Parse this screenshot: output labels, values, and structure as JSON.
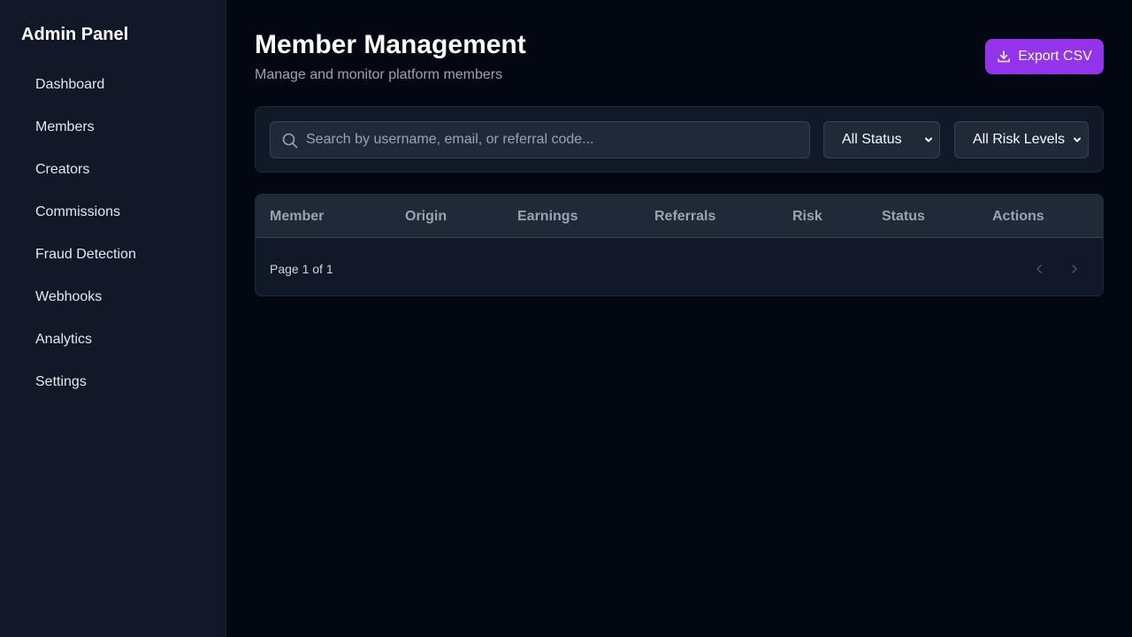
{
  "sidebar": {
    "brand": "Admin Panel",
    "items": [
      {
        "label": "Dashboard"
      },
      {
        "label": "Members"
      },
      {
        "label": "Creators"
      },
      {
        "label": "Commissions"
      },
      {
        "label": "Fraud Detection"
      },
      {
        "label": "Webhooks"
      },
      {
        "label": "Analytics"
      },
      {
        "label": "Settings"
      }
    ]
  },
  "header": {
    "title": "Member Management",
    "subtitle": "Manage and monitor platform members",
    "export_label": "Export CSV"
  },
  "filters": {
    "search_placeholder": "Search by username, email, or referral code...",
    "search_value": "",
    "status_selected": "All Status",
    "risk_selected": "All Risk Levels"
  },
  "table": {
    "columns": [
      "Member",
      "Origin",
      "Earnings",
      "Referrals",
      "Risk",
      "Status",
      "Actions"
    ],
    "rows": [],
    "pagination": "Page 1 of 1"
  },
  "colors": {
    "accent": "#9333ea",
    "background": "#030712",
    "surface": "#111827"
  },
  "icons": {
    "export": "download-icon",
    "search": "search-icon",
    "select": "chevron-down-icon",
    "prev": "chevron-left-icon",
    "next": "chevron-right-icon"
  }
}
